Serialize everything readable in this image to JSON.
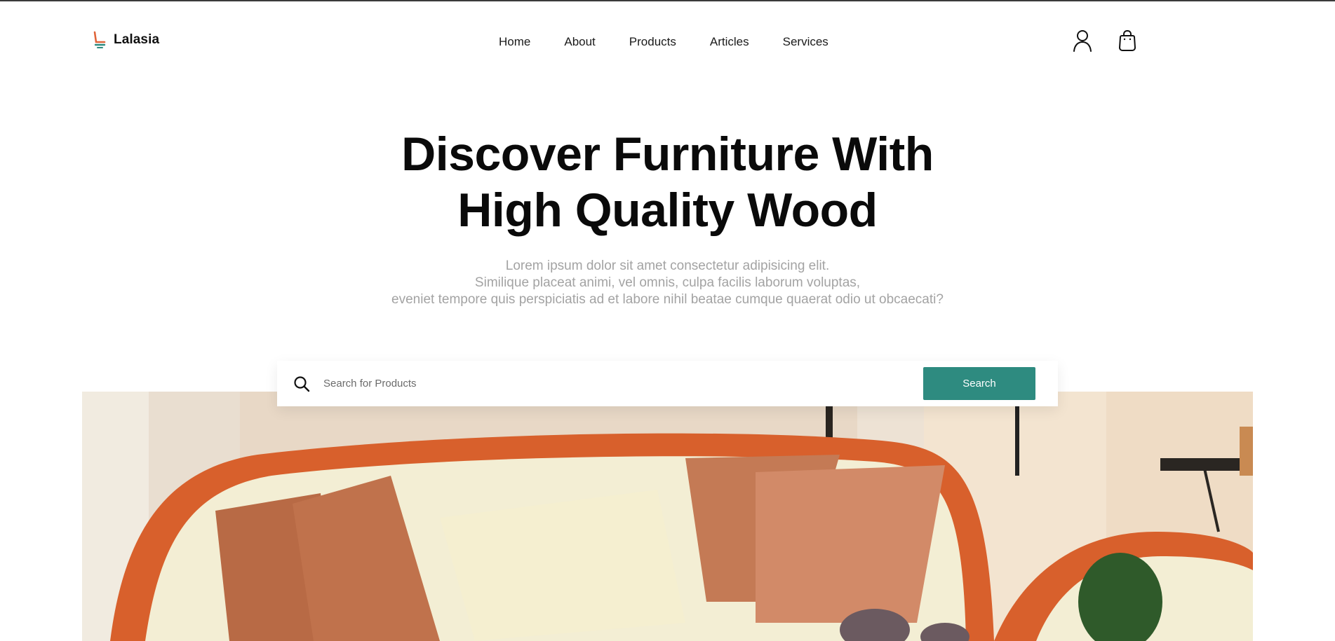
{
  "brand": {
    "name": "Lalasia",
    "logo_icon": "chair-logo-icon"
  },
  "nav": {
    "items": [
      "Home",
      "About",
      "Products",
      "Articles",
      "Services"
    ]
  },
  "header_icons": {
    "account": "user-icon",
    "cart": "shopping-bag-icon"
  },
  "hero": {
    "title_lines": [
      "Discover Furniture With",
      "High Quality Wood"
    ],
    "subtitle_lines": [
      "Lorem ipsum dolor sit amet consectetur adipisicing elit.",
      "Similique placeat animi, vel omnis, culpa facilis laborum voluptas,",
      "eveniet tempore quis perspiciatis ad et labore nihil beatae cumque quaerat odio ut obcaecati?"
    ]
  },
  "search": {
    "placeholder": "Search for Products",
    "value": "",
    "button_label": "Search",
    "icon": "search-icon"
  },
  "colors": {
    "accent": "#2e8b80",
    "logo_orange": "#e0653a",
    "logo_teal": "#2e8b80",
    "subtitle_gray": "#a3a3a3"
  },
  "hero_image": {
    "subject": "wicker-sofa-with-cushions-photo"
  }
}
